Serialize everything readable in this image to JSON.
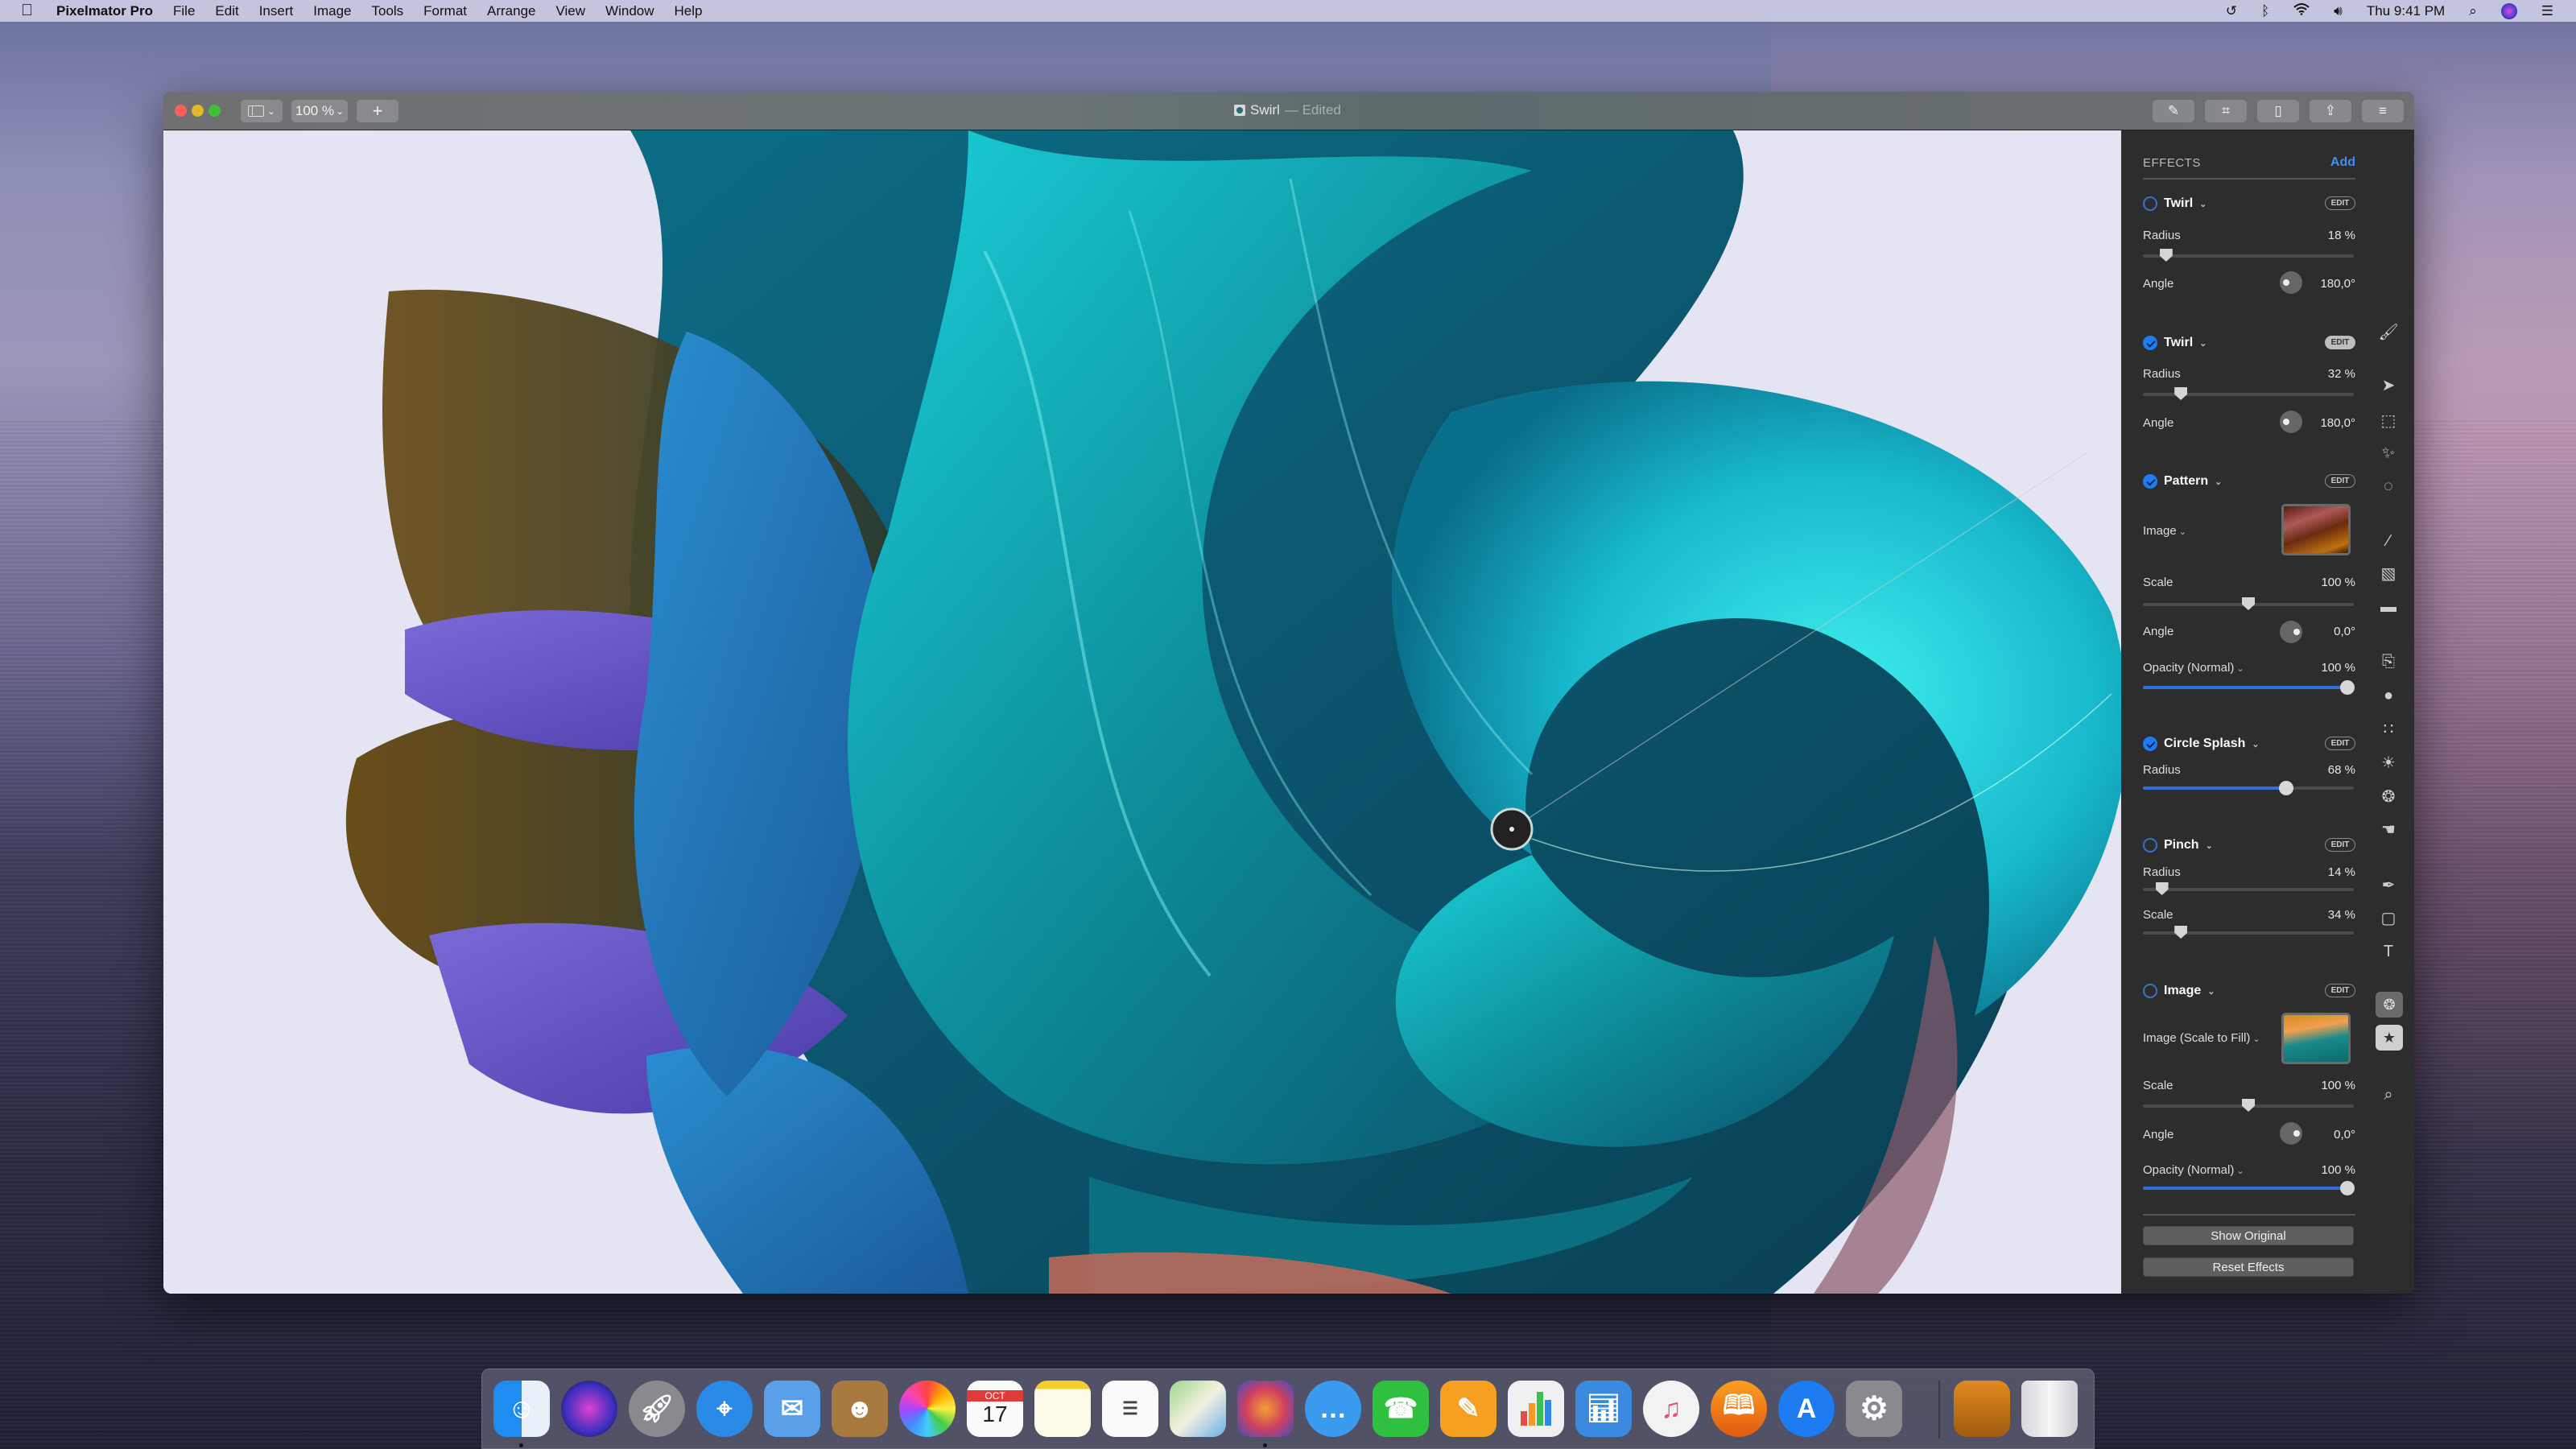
{
  "menubar": {
    "apple_icon": "apple-icon",
    "app_name": "Pixelmator Pro",
    "menus": [
      "File",
      "Edit",
      "Insert",
      "Image",
      "Tools",
      "Format",
      "Arrange",
      "View",
      "Window",
      "Help"
    ],
    "status_icons": [
      "time-machine-icon",
      "bluetooth-icon",
      "wifi-icon",
      "volume-icon"
    ],
    "clock": "Thu 9:41 PM",
    "right_icons": [
      "spotlight-icon",
      "siri-icon",
      "notification-center-icon"
    ]
  },
  "window": {
    "title": "Swirl",
    "title_suffix": "— Edited",
    "zoom_label": "100 %",
    "add_label": "+",
    "toolbar_icons": [
      "pen-icon",
      "crop-icon",
      "document-icon",
      "share-icon",
      "adjustments-icon"
    ]
  },
  "effects": {
    "header": "EFFECTS",
    "add_label": "Add",
    "edit_label": "EDIT",
    "items": [
      {
        "name": "Twirl",
        "enabled": false,
        "edit_active": false,
        "params": [
          {
            "label": "Radius",
            "value": "18 %",
            "fraction": 0.11
          },
          {
            "label": "Angle",
            "value": "180,0°",
            "knob": "left"
          }
        ]
      },
      {
        "name": "Twirl",
        "enabled": true,
        "edit_active": true,
        "params": [
          {
            "label": "Radius",
            "value": "32 %",
            "fraction": 0.18
          },
          {
            "label": "Angle",
            "value": "180,0°",
            "knob": "left"
          }
        ]
      },
      {
        "name": "Pattern",
        "enabled": true,
        "edit_active": false,
        "params": [
          {
            "label": "Image",
            "has_dropdown": true
          },
          {
            "label": "Scale",
            "value": "100 %",
            "fraction": 0.5
          },
          {
            "label": "Angle",
            "value": "0,0°",
            "knob": "right"
          },
          {
            "label": "Opacity (Normal)",
            "has_dropdown": true,
            "value": "100 %",
            "fraction": 1.0
          }
        ]
      },
      {
        "name": "Circle Splash",
        "enabled": true,
        "edit_active": false,
        "params": [
          {
            "label": "Radius",
            "value": "68 %",
            "fraction": 0.68
          }
        ]
      },
      {
        "name": "Pinch",
        "enabled": false,
        "edit_active": false,
        "params": [
          {
            "label": "Radius",
            "value": "14 %",
            "fraction": 0.09
          },
          {
            "label": "Scale",
            "value": "34 %",
            "fraction": 0.18
          }
        ]
      },
      {
        "name": "Image",
        "enabled": false,
        "edit_active": false,
        "params": [
          {
            "label": "Image (Scale to Fill)",
            "has_dropdown": true
          },
          {
            "label": "Scale",
            "value": "100 %",
            "fraction": 0.5
          },
          {
            "label": "Angle",
            "value": "0,0°",
            "knob": "right"
          },
          {
            "label": "Opacity (Normal)",
            "has_dropdown": true,
            "value": "100 %",
            "fraction": 1.0
          }
        ]
      }
    ],
    "show_original": "Show Original",
    "reset_effects": "Reset Effects"
  },
  "tools": [
    "paint-style-icon",
    "arrange-icon",
    "rectangular-selection-icon",
    "magic-wand-icon",
    "quick-selection-icon",
    "paint-icon",
    "fill-icon",
    "erase-icon",
    "repair-icon",
    "clone-icon",
    "sharpen-icon",
    "lighten-icon",
    "color-adjust-icon",
    "warp-icon",
    "pen-tool-icon",
    "shape-icon",
    "type-icon",
    "color-adjustments-icon",
    "effects-icon",
    "zoom-icon"
  ],
  "dock": {
    "apps": [
      {
        "name": "Finder",
        "icon": "finder-icon",
        "running": true
      },
      {
        "name": "Siri",
        "icon": "siri-icon"
      },
      {
        "name": "Launchpad",
        "icon": "launchpad-icon"
      },
      {
        "name": "Safari",
        "icon": "safari-icon"
      },
      {
        "name": "Mail",
        "icon": "mail-icon"
      },
      {
        "name": "Contacts",
        "icon": "contacts-icon"
      },
      {
        "name": "Photos",
        "icon": "photos-icon"
      },
      {
        "name": "Calendar",
        "icon": "calendar-icon",
        "month": "OCT",
        "day": "17"
      },
      {
        "name": "Notes",
        "icon": "notes-icon"
      },
      {
        "name": "Reminders",
        "icon": "reminders-icon"
      },
      {
        "name": "Maps",
        "icon": "maps-icon"
      },
      {
        "name": "Pixelmator Pro",
        "icon": "pixelmator-pro-icon",
        "running": true
      },
      {
        "name": "Messages",
        "icon": "messages-icon"
      },
      {
        "name": "FaceTime",
        "icon": "facetime-icon"
      },
      {
        "name": "Pages",
        "icon": "pages-icon"
      },
      {
        "name": "Numbers",
        "icon": "numbers-icon"
      },
      {
        "name": "Keynote",
        "icon": "keynote-icon"
      },
      {
        "name": "iTunes",
        "icon": "itunes-icon"
      },
      {
        "name": "Books",
        "icon": "books-icon"
      },
      {
        "name": "App Store",
        "icon": "app-store-icon"
      },
      {
        "name": "System Preferences",
        "icon": "system-preferences-icon"
      }
    ],
    "others": [
      {
        "name": "Downloads",
        "icon": "downloads-stack-icon"
      },
      {
        "name": "Trash",
        "icon": "trash-icon"
      }
    ]
  }
}
